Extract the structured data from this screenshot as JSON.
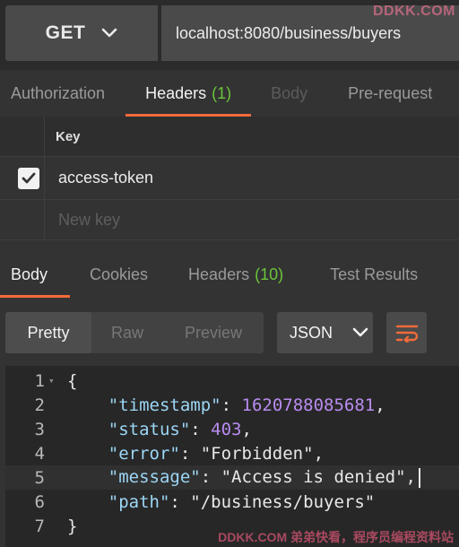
{
  "request": {
    "method": "GET",
    "url": "localhost:8080/business/buyers"
  },
  "watermarks": {
    "top": "DDKK.COM",
    "bottom": "DDKK.COM 弟弟快看，程序员编程资料站"
  },
  "request_tabs": [
    {
      "label": "Authorization"
    },
    {
      "label": "Headers",
      "count": "(1)"
    },
    {
      "label": "Body"
    },
    {
      "label": "Pre-request"
    }
  ],
  "headers_table": {
    "key_header": "Key",
    "rows": [
      {
        "key": "access-token",
        "checked": true
      }
    ],
    "new_key_placeholder": "New key"
  },
  "response_tabs": [
    {
      "label": "Body"
    },
    {
      "label": "Cookies"
    },
    {
      "label": "Headers",
      "count": "(10)"
    },
    {
      "label": "Test Results"
    }
  ],
  "response_formats": [
    "Pretty",
    "Raw",
    "Preview"
  ],
  "response_language": "JSON",
  "response_body": {
    "lines": [
      "1",
      "2",
      "3",
      "4",
      "5",
      "6",
      "7"
    ],
    "open_brace": "{",
    "close_brace": "}",
    "fields": [
      {
        "key": "\"timestamp\"",
        "value": "1620788085681",
        "type": "number"
      },
      {
        "key": "\"status\"",
        "value": "403",
        "type": "number"
      },
      {
        "key": "\"error\"",
        "value": "\"Forbidden\"",
        "type": "string"
      },
      {
        "key": "\"message\"",
        "value": "\"Access is denied\"",
        "type": "string"
      },
      {
        "key": "\"path\"",
        "value": "\"/business/buyers\"",
        "type": "string"
      }
    ]
  },
  "colors": {
    "accent": "#f26b3a",
    "count_green": "#6bc43b",
    "json_key": "#9cd6f5",
    "json_number": "#b98cf0"
  }
}
